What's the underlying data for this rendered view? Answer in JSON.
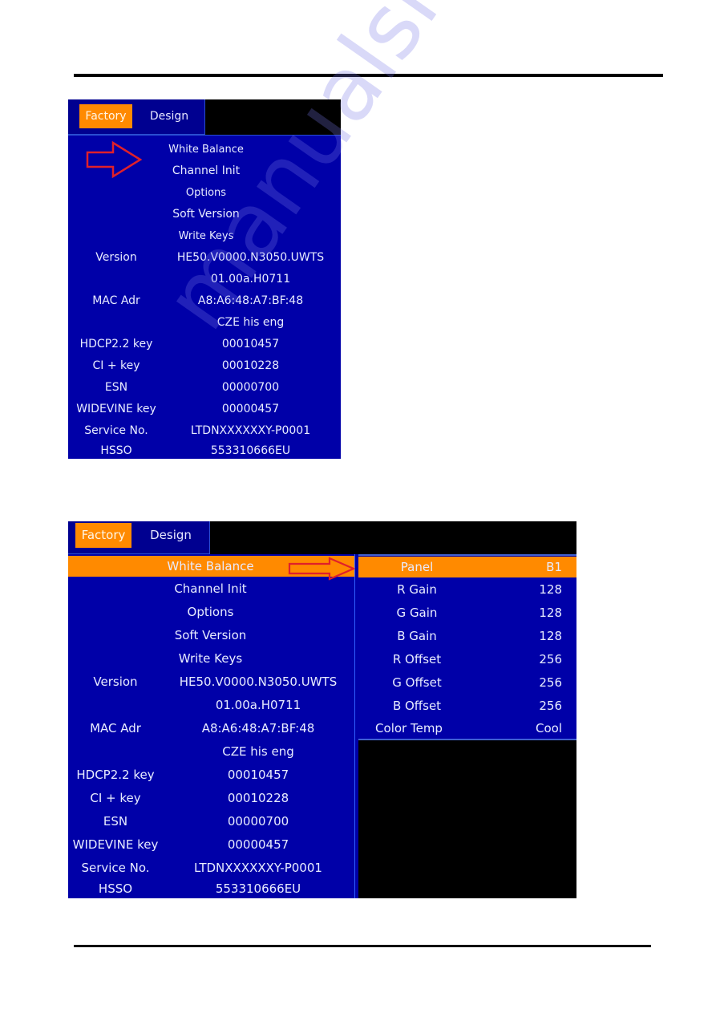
{
  "watermark": "manualshive.com",
  "colors": {
    "menu_bg": "#0000a8",
    "highlight": "#ff8a00",
    "arrow": "#e0202a"
  },
  "menu1": {
    "tabs": [
      "Factory",
      "Design"
    ],
    "items": [
      "White Balance",
      "Channel Init",
      "Options",
      "Soft Version",
      "Write Keys"
    ],
    "info": [
      {
        "label": "Version",
        "value": "HE50.V0000.N3050.UWTS"
      },
      {
        "label": "",
        "value": "01.00a.H0711"
      },
      {
        "label": "MAC Adr",
        "value": "A8:A6:48:A7:BF:48"
      },
      {
        "label": "",
        "value": "CZE his eng"
      },
      {
        "label": "HDCP2.2 key",
        "value": "00010457"
      },
      {
        "label": "CI + key",
        "value": "00010228"
      },
      {
        "label": "ESN",
        "value": "00000700"
      },
      {
        "label": "WIDEVINE key",
        "value": "00000457"
      },
      {
        "label": "Service No.",
        "value": "LTDNXXXXXXY-P0001"
      },
      {
        "label": "HSSO",
        "value": "553310666EU"
      }
    ]
  },
  "menu2": {
    "tabs": [
      "Factory",
      "Design"
    ],
    "items": [
      "White Balance",
      "Channel Init",
      "Options",
      "Soft Version",
      "Write Keys"
    ],
    "info": [
      {
        "label": "Version",
        "value": "HE50.V0000.N3050.UWTS"
      },
      {
        "label": "",
        "value": "01.00a.H0711"
      },
      {
        "label": "MAC Adr",
        "value": "A8:A6:48:A7:BF:48"
      },
      {
        "label": "",
        "value": "CZE his eng"
      },
      {
        "label": "HDCP2.2 key",
        "value": "00010457"
      },
      {
        "label": "CI + key",
        "value": "00010228"
      },
      {
        "label": "ESN",
        "value": "00000700"
      },
      {
        "label": "WIDEVINE key",
        "value": "00000457"
      },
      {
        "label": "Service No.",
        "value": "LTDNXXXXXXY-P0001"
      },
      {
        "label": "HSSO",
        "value": "553310666EU"
      }
    ],
    "submenu": [
      {
        "label": "Panel",
        "value": "B1"
      },
      {
        "label": "R Gain",
        "value": "128"
      },
      {
        "label": "G Gain",
        "value": "128"
      },
      {
        "label": "B Gain",
        "value": "128"
      },
      {
        "label": "R Offset",
        "value": "256"
      },
      {
        "label": "G Offset",
        "value": "256"
      },
      {
        "label": "B Offset",
        "value": "256"
      },
      {
        "label": "Color Temp",
        "value": "Cool"
      }
    ]
  }
}
